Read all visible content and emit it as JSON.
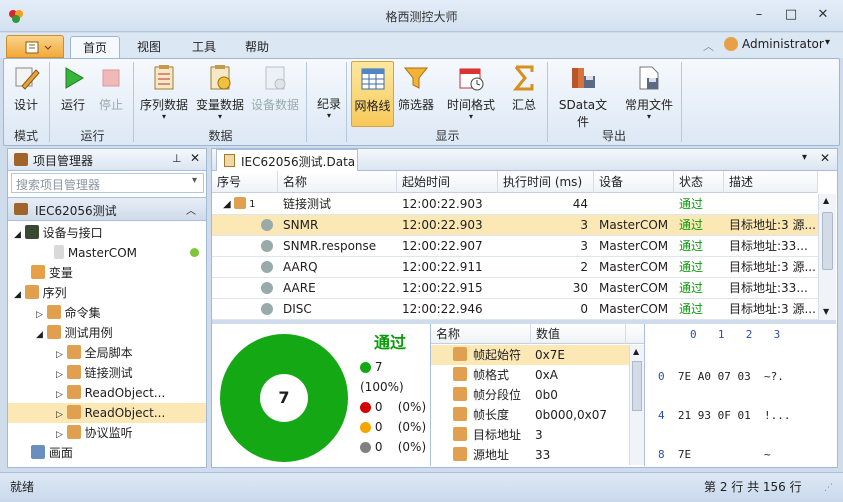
{
  "window": {
    "title": "格西测控大师"
  },
  "tabs": [
    "首页",
    "视图",
    "工具",
    "帮助"
  ],
  "user": "Administrator",
  "ribbon": {
    "buttons": [
      {
        "label": "设计",
        "icon": "design-icon"
      },
      {
        "label": "运行",
        "icon": "run-icon"
      },
      {
        "label": "停止",
        "icon": "stop-icon",
        "disabled": true
      },
      {
        "label": "序列数据",
        "icon": "sequence-data-icon"
      },
      {
        "label": "变量数据",
        "icon": "variable-data-icon"
      },
      {
        "label": "设备数据",
        "icon": "device-data-icon",
        "disabled": true
      },
      {
        "label": "纪录",
        "icon": "record-icon"
      },
      {
        "label": "网格线",
        "icon": "grid-icon",
        "active": true
      },
      {
        "label": "筛选器",
        "icon": "filter-icon"
      },
      {
        "label": "时间格式",
        "icon": "time-format-icon"
      },
      {
        "label": "汇总",
        "icon": "sum-icon"
      },
      {
        "label": "SData文件",
        "icon": "sdata-file-icon"
      },
      {
        "label": "常用文件",
        "icon": "common-file-icon"
      }
    ],
    "groups": [
      "模式",
      "运行",
      "数据",
      "显示",
      "导出"
    ]
  },
  "project": {
    "title": "项目管理器",
    "search_placeholder": "搜索项目管理器",
    "root": "IEC62056测试",
    "tree": [
      "设备与接口",
      "MasterCOM",
      "变量",
      "序列",
      "命令集",
      "测试用例",
      "全局脚本",
      "链接测试",
      "ReadObject...",
      "ReadObject...",
      "协议监听",
      "画面"
    ]
  },
  "doc": {
    "tab": "IEC62056测试.Data"
  },
  "table": {
    "headers": [
      "序号",
      "名称",
      "起始时间",
      "执行时间 (ms)",
      "设备",
      "状态",
      "描述"
    ],
    "rows": [
      {
        "no": "1",
        "name": "链接测试",
        "start": "12:00:22.903",
        "exec": "44",
        "device": "",
        "status": "通过",
        "desc": ""
      },
      {
        "no": "",
        "name": "SNMR",
        "start": "12:00:22.903",
        "exec": "3",
        "device": "MasterCOM",
        "status": "通过",
        "desc": "目标地址:3 源..."
      },
      {
        "no": "",
        "name": "SNMR.response",
        "start": "12:00:22.907",
        "exec": "3",
        "device": "MasterCOM",
        "status": "通过",
        "desc": "目标地址:33..."
      },
      {
        "no": "",
        "name": "AARQ",
        "start": "12:00:22.911",
        "exec": "2",
        "device": "MasterCOM",
        "status": "通过",
        "desc": "目标地址:3 源..."
      },
      {
        "no": "",
        "name": "AARE",
        "start": "12:00:22.915",
        "exec": "30",
        "device": "MasterCOM",
        "status": "通过",
        "desc": "目标地址:33..."
      },
      {
        "no": "",
        "name": "DISC",
        "start": "12:00:22.946",
        "exec": "0",
        "device": "MasterCOM",
        "status": "通过",
        "desc": "目标地址:3 源..."
      }
    ]
  },
  "summary": {
    "result": "通过",
    "count": "7",
    "items": [
      "7 (100%)",
      "0    (0%)",
      "0    (0%)",
      "0    (0%)"
    ],
    "colors": [
      "#14a814",
      "#d40000",
      "#f5a400",
      "#808080"
    ]
  },
  "props": {
    "headers": [
      "名称",
      "数值"
    ],
    "rows": [
      [
        "帧起始符",
        "0x7E"
      ],
      [
        "帧格式",
        "0xA"
      ],
      [
        "帧分段位",
        "0b0"
      ],
      [
        "帧长度",
        "0b000,0x07"
      ],
      [
        "目标地址",
        "3"
      ],
      [
        "源地址",
        "33"
      ]
    ]
  },
  "hex": {
    "header": "0  1  2  3",
    "lines": [
      [
        "0",
        "7E A0 07 03",
        "~?."
      ],
      [
        "4",
        "21 93 0F 01",
        "!..."
      ],
      [
        "8",
        "7E",
        "~"
      ]
    ]
  },
  "status": {
    "left": "就绪",
    "right": "第 2 行 共 156 行"
  }
}
